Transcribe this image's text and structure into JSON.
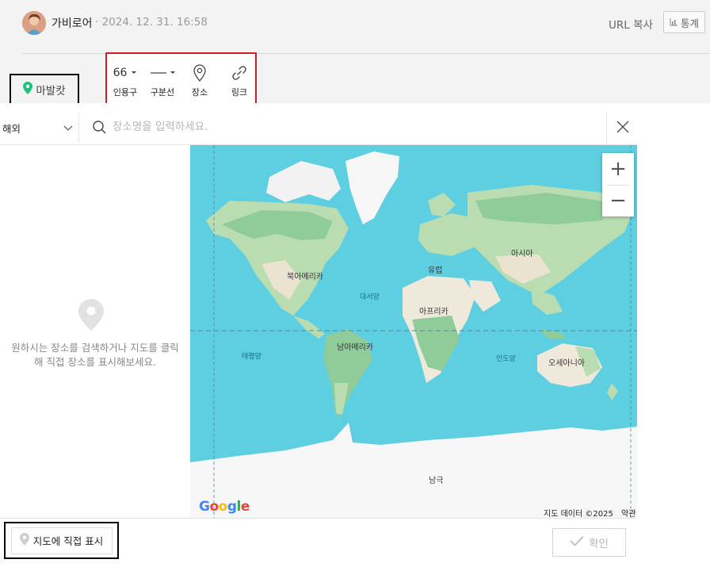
{
  "header": {
    "author": "가비로어",
    "datetime": "· 2024. 12. 31. 16:58",
    "url_copy": "URL 복사",
    "stats": "통계"
  },
  "editor": {
    "mabalkat_label": "마발캇",
    "toolbar": [
      {
        "label": "인용구",
        "icon": "quote-icon"
      },
      {
        "label": "구분선",
        "icon": "divider-icon"
      },
      {
        "label": "장소",
        "icon": "location-pin-icon"
      },
      {
        "label": "링크",
        "icon": "link-icon"
      }
    ],
    "quote_glyph": "66"
  },
  "place_panel": {
    "region": "해외",
    "search_placeholder": "장소명을 입력하세요.",
    "hint": "원하시는 장소를 검색하거나 지도를 클릭해 직접 장소를 표시해보세요.",
    "direct_mark_label": "지도에 직접 표시",
    "confirm_label": "확인"
  },
  "map": {
    "labels": {
      "north_america": "북아메리카",
      "south_america": "남아메리카",
      "europe": "유럽",
      "asia": "아시아",
      "africa": "아프리카",
      "oceania": "오세아니아",
      "antarctica": "남극",
      "atlantic": "대서양",
      "pacific": "태평양",
      "indian": "인도양"
    },
    "zoom_in": "+",
    "zoom_out": "−",
    "google": "Google",
    "credit": "지도 데이터 ©2025",
    "terms": "약관",
    "colors": {
      "ocean": "#5ecfe0",
      "land": "#b9dcb0",
      "forest": "#8fcc9a",
      "desert": "#efe9dc",
      "ice": "#f7f7f7"
    }
  }
}
